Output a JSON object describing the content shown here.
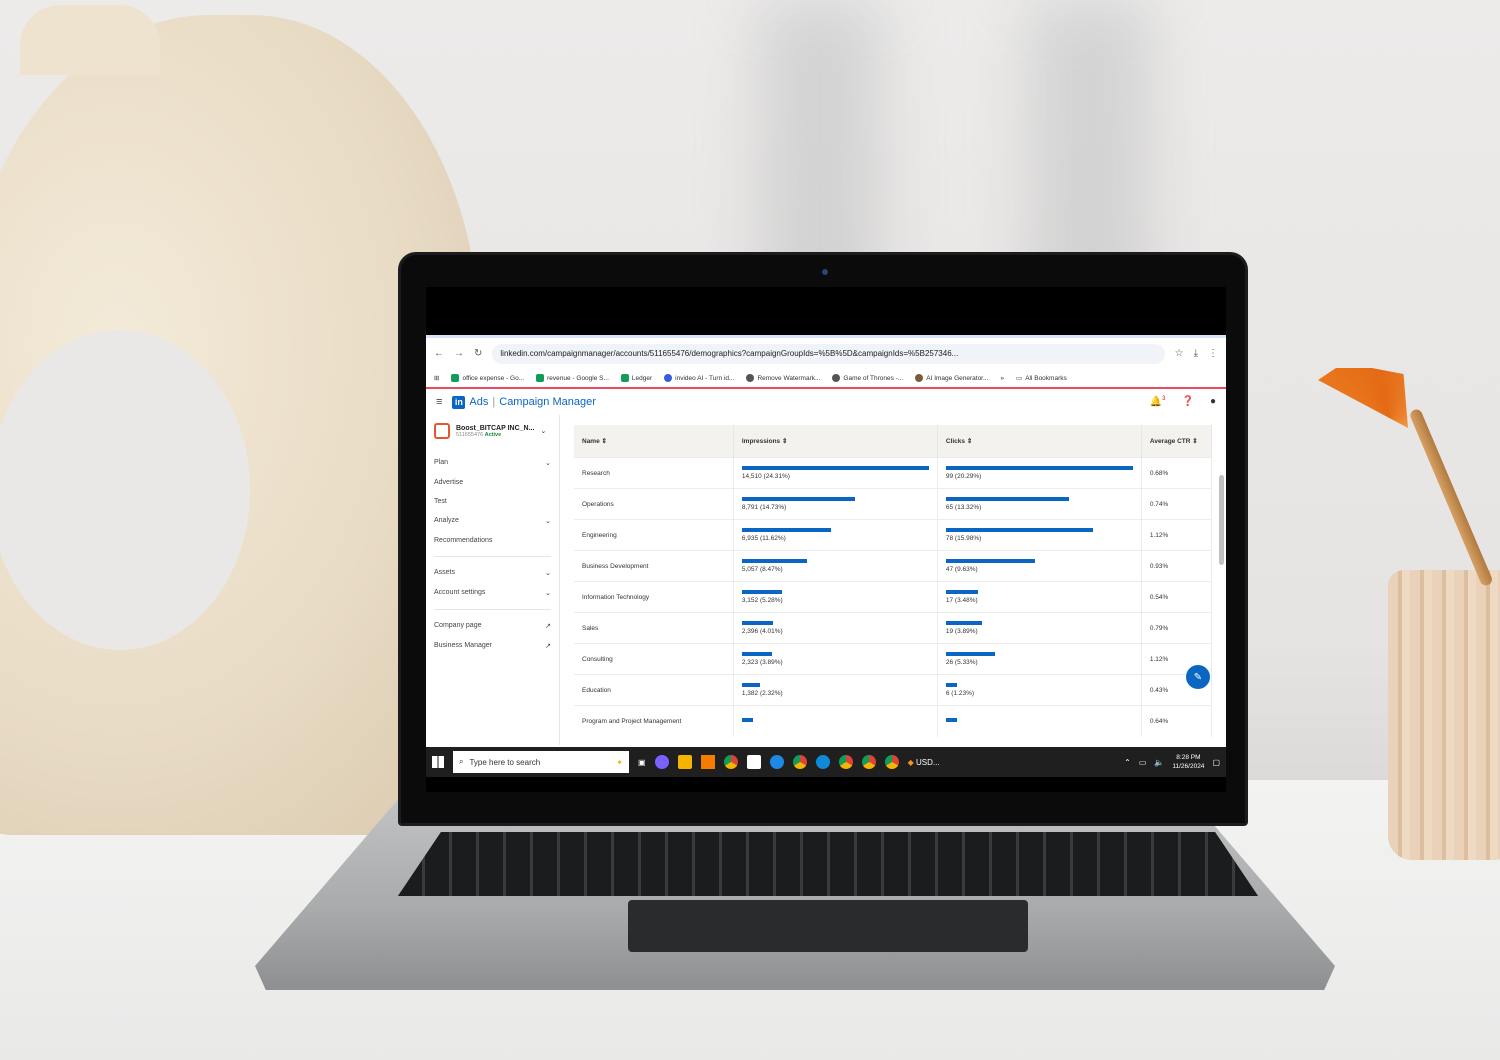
{
  "browser": {
    "url": "linkedin.com/campaignmanager/accounts/511655476/demographics?campaignGroupIds=%5B%5D&campaignIds=%5B257346...",
    "bookmarks": [
      "office expense - Go...",
      "revenue - Google S...",
      "Ledger",
      "invideo AI - Turn id...",
      "Remove Watermark...",
      "Game of Thrones -...",
      "AI Image Generator..."
    ],
    "overflow": "»",
    "all_bookmarks": "All Bookmarks"
  },
  "app": {
    "brand_ads": "Ads",
    "brand_sep": "|",
    "brand_title": "Campaign Manager",
    "notification_count": "3"
  },
  "account": {
    "name": "Boost_BITCAP INC_N...",
    "id": "511655476",
    "status": "Active"
  },
  "sidebar": {
    "items": [
      {
        "label": "Plan",
        "chevron": "⌄"
      },
      {
        "label": "Advertise",
        "chevron": ""
      },
      {
        "label": "Test",
        "chevron": ""
      },
      {
        "label": "Analyze",
        "chevron": "⌄"
      },
      {
        "label": "Recommendations",
        "chevron": ""
      }
    ],
    "items2": [
      {
        "label": "Assets",
        "chevron": "⌄"
      },
      {
        "label": "Account settings",
        "chevron": "⌄"
      }
    ],
    "items3": [
      {
        "label": "Company page",
        "chevron": "↗"
      },
      {
        "label": "Business Manager",
        "chevron": "↗"
      }
    ]
  },
  "table": {
    "headers": [
      "Name",
      "Impressions",
      "Clicks",
      "Average CTR"
    ],
    "rows": [
      {
        "name": "Research",
        "impressions": "14,510 (24.31%)",
        "imp_pct": 24.31,
        "clicks": "99 (20.29%)",
        "click_pct": 20.29,
        "ctr": "0.68%"
      },
      {
        "name": "Operations",
        "impressions": "8,791 (14.73%)",
        "imp_pct": 14.73,
        "clicks": "65 (13.32%)",
        "click_pct": 13.32,
        "ctr": "0.74%"
      },
      {
        "name": "Engineering",
        "impressions": "6,935 (11.62%)",
        "imp_pct": 11.62,
        "clicks": "78 (15.98%)",
        "click_pct": 15.98,
        "ctr": "1.12%"
      },
      {
        "name": "Business Development",
        "impressions": "5,057 (8.47%)",
        "imp_pct": 8.47,
        "clicks": "47 (9.63%)",
        "click_pct": 9.63,
        "ctr": "0.93%"
      },
      {
        "name": "Information Technology",
        "impressions": "3,152 (5.28%)",
        "imp_pct": 5.28,
        "clicks": "17 (3.48%)",
        "click_pct": 3.48,
        "ctr": "0.54%"
      },
      {
        "name": "Sales",
        "impressions": "2,396 (4.01%)",
        "imp_pct": 4.01,
        "clicks": "19 (3.89%)",
        "click_pct": 3.89,
        "ctr": "0.79%"
      },
      {
        "name": "Consulting",
        "impressions": "2,323 (3.89%)",
        "imp_pct": 3.89,
        "clicks": "26 (5.33%)",
        "click_pct": 5.33,
        "ctr": "1.12%"
      },
      {
        "name": "Education",
        "impressions": "1,382 (2.32%)",
        "imp_pct": 2.32,
        "clicks": "6 (1.23%)",
        "click_pct": 1.23,
        "ctr": "0.43%"
      },
      {
        "name": "Program and Project Management",
        "impressions": "",
        "imp_pct": 1.5,
        "clicks": "",
        "click_pct": 1.2,
        "ctr": "0.64%"
      }
    ]
  },
  "taskbar": {
    "search_placeholder": "Type here to search",
    "currency": "USD...",
    "time": "8:28 PM",
    "date": "11/26/2024"
  },
  "colors": {
    "accent": "#0a66c2",
    "status_active": "#1a8a3c",
    "bookmark_bar_line": "#e84a5f"
  }
}
